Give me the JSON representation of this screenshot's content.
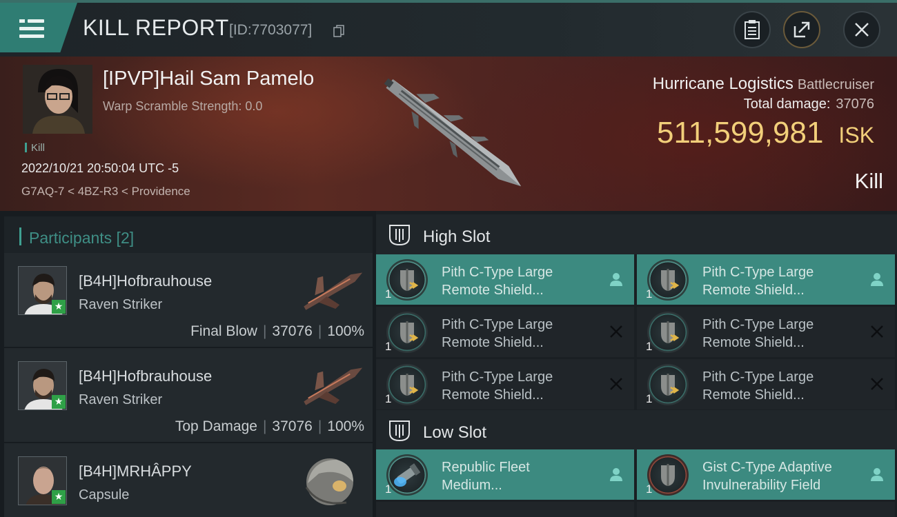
{
  "header": {
    "title": "KILL REPORT",
    "report_id": "[ID:7703077]"
  },
  "banner": {
    "victim_name": "[IPVP]Hail Sam Pamelo",
    "warp_scramble": "Warp Scramble Strength: 0.0",
    "tag": "Kill",
    "datetime": "2022/10/21 20:50:04 UTC -5",
    "location": "G7AQ-7 < 4BZ-R3 < Providence",
    "ship_name": "Hurricane Logistics",
    "ship_class": "Battlecruiser",
    "total_damage_label": "Total damage:",
    "total_damage": "37076",
    "isk_value": "511,599,981",
    "isk_unit": "ISK",
    "kill_type": "Kill"
  },
  "participants": {
    "header": "Participants [2]",
    "rows": [
      {
        "name": "[B4H]Hofbrauhouse",
        "ship": "Raven Striker",
        "role": "Final Blow",
        "damage": "37076",
        "percent": "100%"
      },
      {
        "name": "[B4H]Hofbrauhouse",
        "ship": "Raven Striker",
        "role": "Top Damage",
        "damage": "37076",
        "percent": "100%"
      },
      {
        "name": "[B4H]MRHÂPPY",
        "ship": "Capsule"
      }
    ]
  },
  "fittings": {
    "high_slot_label": "High Slot",
    "low_slot_label": "Low Slot",
    "high": [
      {
        "line1": "Pith C-Type Large",
        "line2": "Remote Shield...",
        "qty": "1",
        "status": "fitted"
      },
      {
        "line1": "Pith C-Type Large",
        "line2": "Remote Shield...",
        "qty": "1",
        "status": "fitted"
      },
      {
        "line1": "Pith C-Type Large",
        "line2": "Remote Shield...",
        "qty": "1",
        "status": "destroyed"
      },
      {
        "line1": "Pith C-Type Large",
        "line2": "Remote Shield...",
        "qty": "1",
        "status": "destroyed"
      },
      {
        "line1": "Pith C-Type Large",
        "line2": "Remote Shield...",
        "qty": "1",
        "status": "destroyed"
      },
      {
        "line1": "Pith C-Type Large",
        "line2": "Remote Shield...",
        "qty": "1",
        "status": "destroyed"
      }
    ],
    "low": [
      {
        "line1": "Republic Fleet",
        "line2": "Medium...",
        "qty": "1",
        "status": "fitted"
      },
      {
        "line1": "Gist C-Type Adaptive",
        "line2": "Invulnerability Field",
        "qty": "1",
        "status": "fitted"
      }
    ]
  }
}
